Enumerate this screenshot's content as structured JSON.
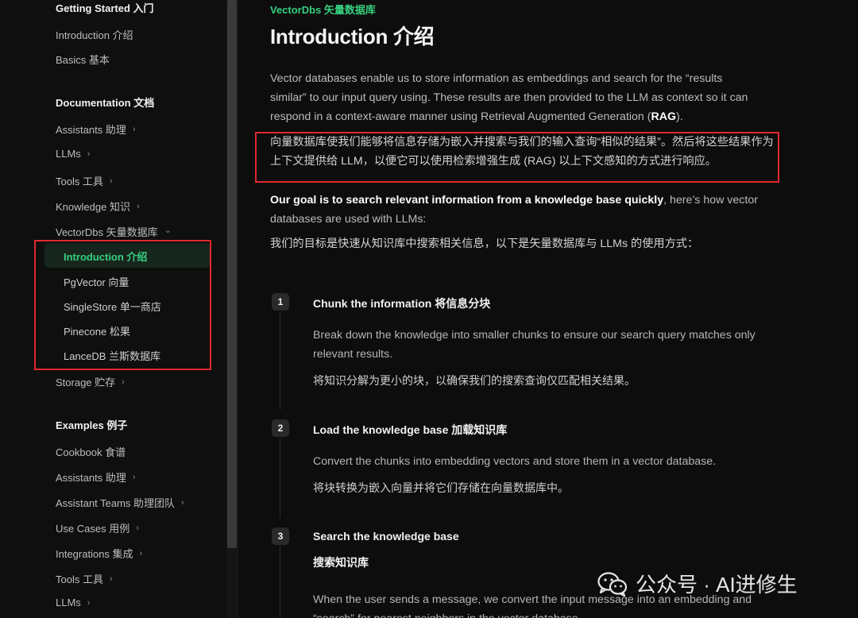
{
  "sidebar": {
    "getting_started": {
      "title": "Getting Started 入门",
      "items": [
        "Introduction 介绍",
        "Basics 基本"
      ]
    },
    "documentation": {
      "title": "Documentation 文档",
      "items": [
        {
          "label": "Assistants 助理",
          "chevron": "›"
        },
        {
          "label": "LLMs",
          "chevron": "›"
        },
        {
          "label": "Tools 工具",
          "chevron": "›"
        },
        {
          "label": "Knowledge 知识",
          "chevron": "›"
        },
        {
          "label": "VectorDbs 矢量数据库",
          "chevron": "⌄"
        }
      ],
      "vectordbs_children": [
        {
          "label": "Introduction 介绍",
          "active": true
        },
        {
          "label": "PgVector 向量"
        },
        {
          "label": "SingleStore 单一商店"
        },
        {
          "label": "Pinecone 松果"
        },
        {
          "label": "LanceDB 兰斯数据库"
        }
      ],
      "storage": {
        "label": "Storage 贮存",
        "chevron": "›"
      }
    },
    "examples": {
      "title": "Examples 例子",
      "items": [
        {
          "label": "Cookbook 食谱",
          "chevron": ""
        },
        {
          "label": "Assistants 助理",
          "chevron": "›"
        },
        {
          "label": "Assistant Teams 助理团队",
          "chevron": "›"
        },
        {
          "label": "Use Cases 用例",
          "chevron": "›"
        },
        {
          "label": "Integrations 集成",
          "chevron": "›"
        },
        {
          "label": "Tools 工具",
          "chevron": "›"
        },
        {
          "label": "LLMs",
          "chevron": "›"
        }
      ]
    }
  },
  "main": {
    "eyebrow": "VectorDbs 矢量数据库",
    "title": "Introduction 介绍",
    "intro_before": "Vector databases enable us to store information as embeddings and search for the “results similar” to our input query using. These results are then provided to the LLM as context so it can respond in a context-aware manner using Retrieval Augmented Generation (",
    "intro_bold": "RAG",
    "intro_after": ").",
    "intro_cn_line1": "向量数据库使我们能够将信息存储为嵌入并搜索与我们的输入查询“相似的结果”。然后将这些结果作为",
    "intro_cn_line2": "上下文提供给 LLM，以便它可以使用检索增强生成 (RAG) 以上下文感知的方式进行响应。",
    "goal_bold": "Our goal is to search relevant information from a knowledge base quickly",
    "goal_rest": ", here’s how vector databases are used with LLMs:",
    "goal_cn": "我们的目标是快速从知识库中搜索相关信息，以下是矢量数据库与 LLMs 的使用方式：",
    "steps": [
      {
        "num": "1",
        "title": "Chunk the information 将信息分块",
        "text": "Break down the knowledge into smaller chunks to ensure our search query matches only relevant results.",
        "cn": "将知识分解为更小的块，以确保我们的搜索查询仅匹配相关结果。"
      },
      {
        "num": "2",
        "title": "Load the knowledge base 加载知识库",
        "text": "Convert the chunks into embedding vectors and store them in a vector database.",
        "cn": "将块转换为嵌入向量并将它们存储在向量数据库中。"
      },
      {
        "num": "3",
        "title": "Search the knowledge base",
        "title_cn": "搜索知识库",
        "text": "When the user sends a message, we convert the input message into an embedding and “search” for nearest neighbors in the vector database."
      }
    ]
  },
  "watermark": {
    "icon": "wechat-icon",
    "text": "公众号 · AI进修生"
  },
  "colors": {
    "accent": "#35d07f",
    "highlight_box": "#e0282e",
    "background": "#0d0d0d"
  }
}
